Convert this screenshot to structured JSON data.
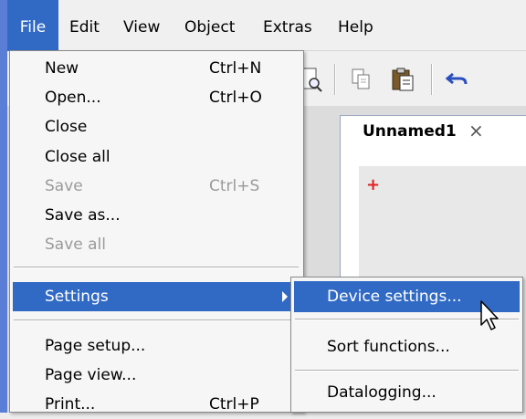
{
  "menubar": {
    "items": [
      {
        "label": "File"
      },
      {
        "label": "Edit"
      },
      {
        "label": "View"
      },
      {
        "label": "Object"
      },
      {
        "label": "Extras"
      },
      {
        "label": "Help"
      }
    ]
  },
  "toolbar": {
    "icons": [
      "print-preview-icon",
      "copy-icon",
      "paste-icon",
      "undo-icon"
    ]
  },
  "document": {
    "tab_label": "Unnamed1",
    "close_glyph": "×",
    "marker_glyph": "+"
  },
  "file_menu": {
    "items": [
      {
        "label": "New",
        "shortcut": "Ctrl+N"
      },
      {
        "label": "Open...",
        "shortcut": "Ctrl+O"
      },
      {
        "label": "Close",
        "shortcut": ""
      },
      {
        "label": "Close all",
        "shortcut": ""
      },
      {
        "label": "Save",
        "shortcut": "Ctrl+S"
      },
      {
        "label": "Save as...",
        "shortcut": ""
      },
      {
        "label": "Save all",
        "shortcut": ""
      },
      {
        "label": "Settings",
        "shortcut": ""
      },
      {
        "label": "Page setup...",
        "shortcut": ""
      },
      {
        "label": "Page view...",
        "shortcut": ""
      },
      {
        "label": "Print...",
        "shortcut": "Ctrl+P"
      }
    ]
  },
  "settings_submenu": {
    "items": [
      {
        "label": "Device settings..."
      },
      {
        "label": "Sort functions..."
      },
      {
        "label": "Datalogging..."
      }
    ]
  },
  "colors": {
    "highlight": "#316ac5",
    "disabled_text": "#9a9a9a",
    "marker": "#e02020"
  }
}
